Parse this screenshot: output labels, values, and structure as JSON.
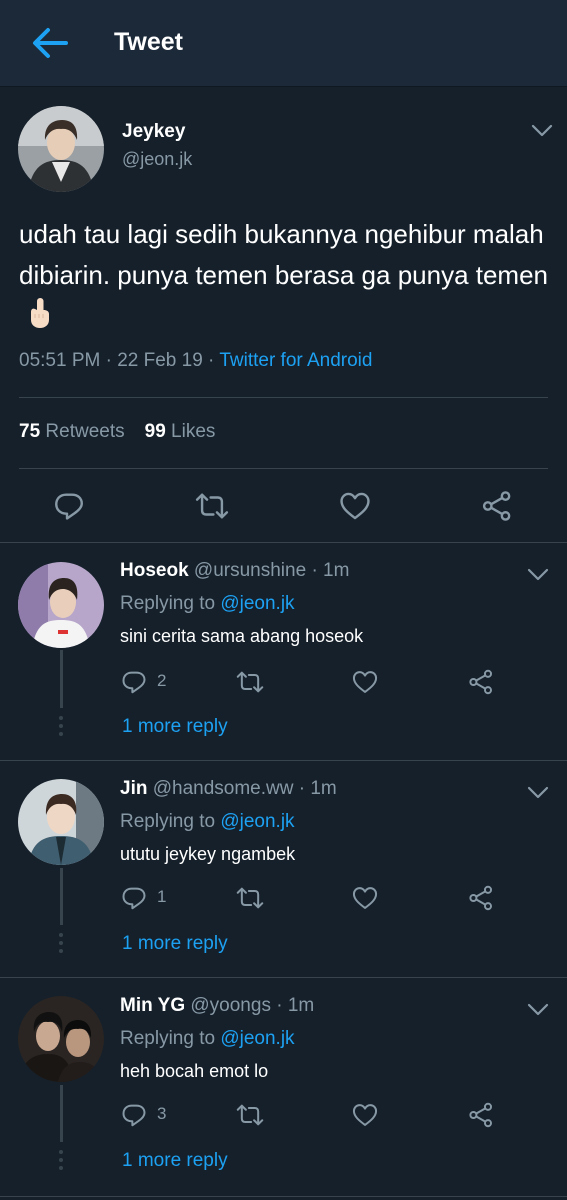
{
  "header": {
    "title": "Tweet",
    "back_icon": "arrow-left-icon",
    "accent": "#1da1f2"
  },
  "main_tweet": {
    "name": "Jeykey",
    "handle": "@jeon.jk",
    "text": "udah tau lagi sedih bukannya ngehibur malah dibiarin. punya temen berasa ga punya temen",
    "emoji": "middle-finger-emoji",
    "time": "05:51 PM · 22 Feb 19 · ",
    "client": "Twitter for Android",
    "retweets_count": "75",
    "retweets_label": "Retweets",
    "likes_count": "99",
    "likes_label": "Likes"
  },
  "replies": [
    {
      "name": "Hoseok",
      "handle_time": "@ursunshine · 1m",
      "replying_to_label": "Replying to",
      "replying_to": "@jeon.jk",
      "text": "sini cerita sama abang hoseok",
      "reply_count": "2",
      "more_replies": "1 more reply"
    },
    {
      "name": "Jin",
      "handle_time": "@handsome.ww · 1m",
      "replying_to_label": "Replying to",
      "replying_to": "@jeon.jk",
      "text": "ututu jeykey ngambek",
      "reply_count": "1",
      "more_replies": "1 more reply"
    },
    {
      "name": "Min YG",
      "handle_time": "@yoongs · 1m",
      "replying_to_label": "Replying to",
      "replying_to": "@jeon.jk",
      "text": "heh bocah emot lo",
      "reply_count": "3",
      "more_replies": "1 more reply"
    }
  ]
}
